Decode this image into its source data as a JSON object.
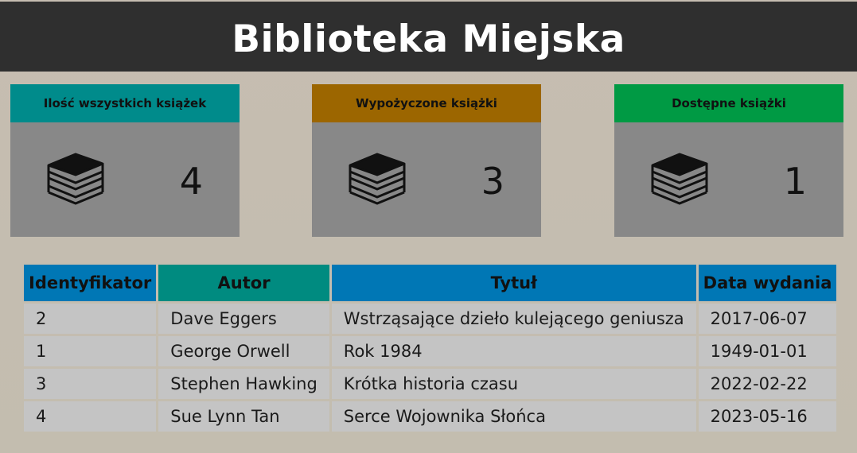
{
  "header": {
    "title": "Biblioteka Miejska"
  },
  "cards": [
    {
      "label": "Ilość wszystkich książek",
      "value": "4",
      "color": "#008b8b",
      "icon": "books-icon"
    },
    {
      "label": "Wypożyczone książki",
      "value": "3",
      "color": "#9c6600",
      "icon": "books-icon"
    },
    {
      "label": "Dostępne książki",
      "value": "1",
      "color": "#009a44",
      "icon": "books-icon"
    }
  ],
  "table": {
    "columns": [
      {
        "label": "Identyfikator",
        "color": "#0077b5"
      },
      {
        "label": "Autor",
        "color": "#008b80"
      },
      {
        "label": "Tytuł",
        "color": "#0077b5"
      },
      {
        "label": "Data wydania",
        "color": "#0077b5"
      }
    ],
    "rows": [
      [
        "2",
        "Dave Eggers",
        "Wstrząsające dzieło kulejącego geniusza",
        "2017-06-07"
      ],
      [
        "1",
        "George Orwell",
        "Rok 1984",
        "1949-01-01"
      ],
      [
        "3",
        "Stephen Hawking",
        "Krótka historia czasu",
        "2022-02-22"
      ],
      [
        "4",
        "Sue Lynn Tan",
        "Serce Wojownika Słońca",
        "2023-05-16"
      ]
    ]
  }
}
